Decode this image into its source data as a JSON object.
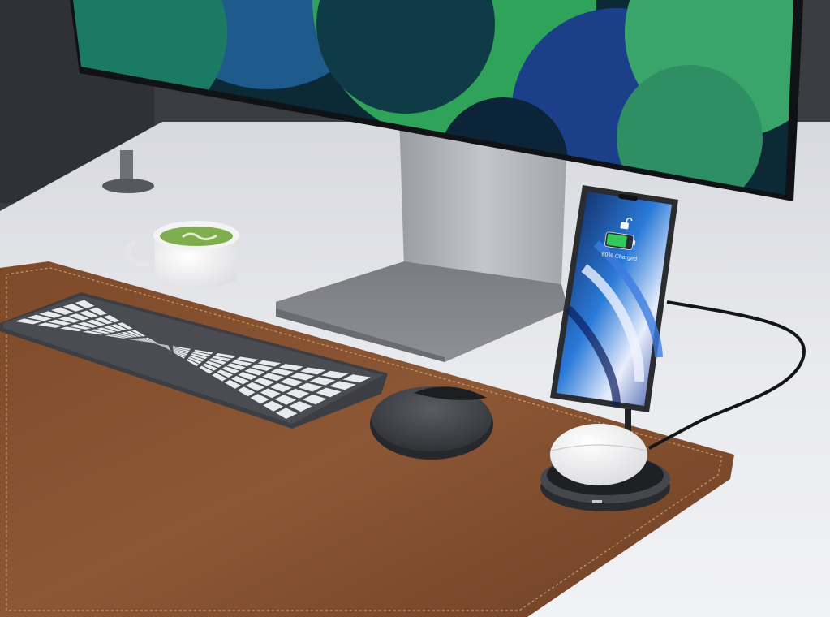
{
  "phone_screen": {
    "battery_label": "80% Charged",
    "battery_level": 0.8
  },
  "palette": {
    "wall": "#3b3d42",
    "desk": "#e6e7ec",
    "desk_mat": "#8a5634",
    "monitor_screen_green": "#2fa35a",
    "monitor_screen_blue": "#1c3f8a",
    "battery_green": "#34c759"
  }
}
